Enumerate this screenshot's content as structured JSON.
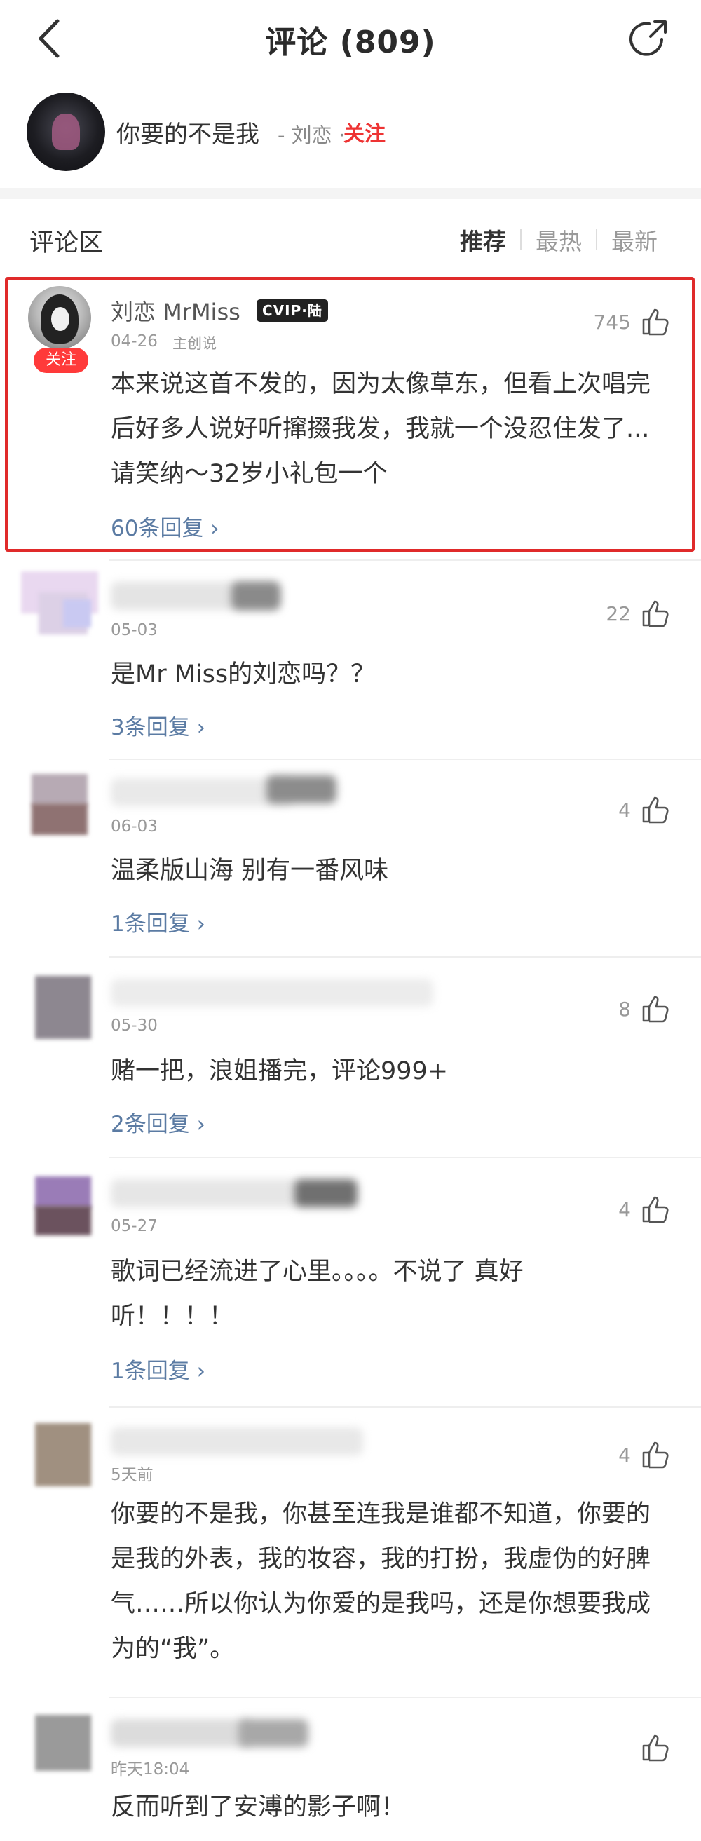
{
  "header": {
    "title": "评论 (809)"
  },
  "song": {
    "title": "你要的不是我",
    "artist": "- 刘恋 ·",
    "follow_label": "关注"
  },
  "section": {
    "title": "评论区",
    "tabs": [
      "推荐",
      "最热",
      "最新"
    ],
    "active_tab": "推荐"
  },
  "comments": [
    {
      "username": "刘恋 MrMiss",
      "badge": "CVIP·陆",
      "follow_badge": "关注",
      "date": "04-26",
      "creator_tag": "主创说",
      "likes": "745",
      "text": "本来说这首不发的，因为太像草东，但看上次唱完后好多人说好听撺掇我发，我就一个没忍住发了...请笑纳～32岁小礼包一个",
      "replies": "60条回复 ›"
    },
    {
      "date": "05-03",
      "likes": "22",
      "text": "是Mr Miss的刘恋吗？？",
      "replies": "3条回复 ›"
    },
    {
      "date": "06-03",
      "likes": "4",
      "text": "温柔版山海 别有一番风味",
      "replies": "1条回复 ›"
    },
    {
      "date": "05-30",
      "likes": "8",
      "text": "赌一把，浪姐播完，评论999+",
      "replies": "2条回复 ›"
    },
    {
      "date": "05-27",
      "likes": "4",
      "text": "歌词已经流进了心里。。。。不说了 真好听！！！！",
      "replies": "1条回复 ›"
    },
    {
      "date": "5天前",
      "likes": "4",
      "text": "你要的不是我，你甚至连我是谁都不知道，你要的是我的外表，我的妆容，我的打扮，我虚伪的好脾气……所以你认为你爱的是我吗，还是你想要我成为的“我”。",
      "replies": ""
    },
    {
      "date": "昨天18:04",
      "likes": "",
      "text": "反而听到了安溥的影子啊！",
      "replies": ""
    }
  ],
  "colors": {
    "accent_red": "#e33333",
    "reply_link": "#5b7ba3",
    "highlight_border": "#e02a2a"
  },
  "icons": [
    "back-arrow-icon",
    "share-icon",
    "thumbs-up-icon",
    "chevron-right-icon"
  ]
}
